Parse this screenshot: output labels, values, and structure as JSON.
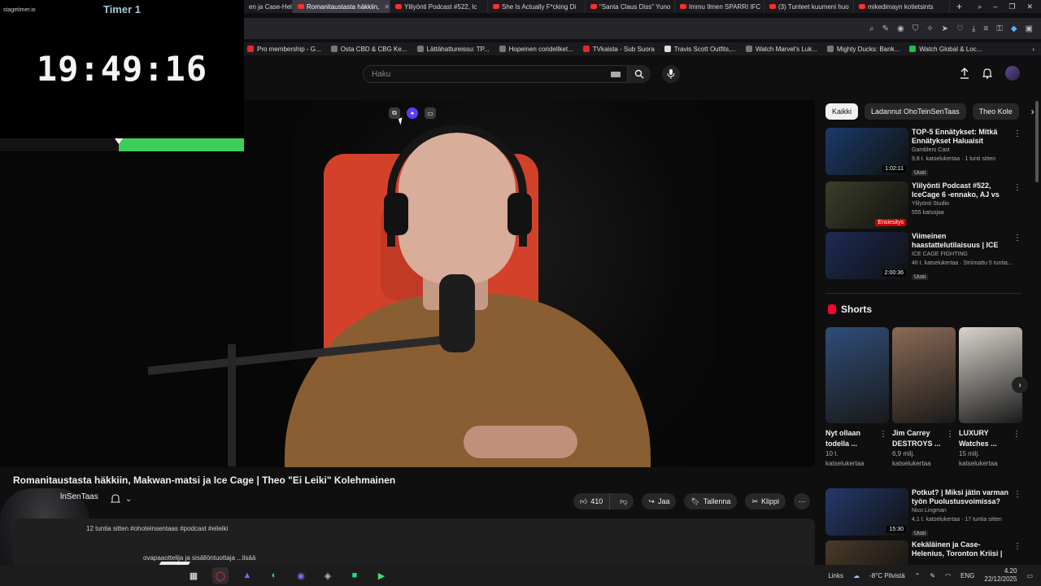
{
  "browser": {
    "tabs": [
      {
        "label": "en ja Case-Heler",
        "active": false
      },
      {
        "label": "Romanitaustasta häkkiin,",
        "active": true
      },
      {
        "label": "Ylilyönti Podcast #522, Ic",
        "active": false
      },
      {
        "label": "She Is Actually F*cking Di",
        "active": false
      },
      {
        "label": "\"Santa Claus Diss\" Yuno",
        "active": false
      },
      {
        "label": "Immu Ilmen SPARRI IFC",
        "active": false
      },
      {
        "label": "(3) Tunteet kuumeni huo",
        "active": false
      },
      {
        "label": "mikedimayn kotietsints",
        "active": false
      }
    ],
    "new_tab": "+",
    "bookmarks": [
      {
        "label": "Pro membership - G...",
        "icon": "red"
      },
      {
        "label": "Osta CBD & CBG Ke...",
        "icon": "gray"
      },
      {
        "label": "Lättähattureissu: TP...",
        "icon": "gray"
      },
      {
        "label": "Hopeinen coridellket...",
        "icon": "gray"
      },
      {
        "label": "TVkaista - Sub Suora",
        "icon": "red"
      },
      {
        "label": "Travis Scott Outfits,...",
        "icon": "wht"
      },
      {
        "label": "Watch Marvel's Luk...",
        "icon": "gray"
      },
      {
        "label": "Mighty Ducks: Bank...",
        "icon": "gray"
      },
      {
        "label": "Watch Global & Loc...",
        "icon": "grn"
      }
    ]
  },
  "timer": {
    "brand": "stagetimer.io",
    "title": "Timer 1",
    "time": "19:49:16",
    "progress": 0.485,
    "fill_color": "#3ecf5a"
  },
  "header": {
    "search_placeholder": "Haku"
  },
  "video": {
    "title": "Romanitaustasta häkkiin, Makwan-matsi ja Ice Cage | Theo \"Ei Leiki\" Kolehmainen",
    "channel": "lnSenTaas",
    "likes": "410",
    "share": "Jaa",
    "save": "Tallenna",
    "clip": "Klippi",
    "desc_line1": "12 tuntia sitten  #ohoteinsentaas #podcast #eileiki",
    "desc_line2": "ovapaaottelija ja sisällöntuottaja  ...lisää"
  },
  "chips": [
    "Kaikki",
    "Ladannut OhoTeinSenTaas",
    "Theo Kole"
  ],
  "recommendations": [
    {
      "title": "TOP-5 Ennätykset: Mitkä Ennätykset Haluaisit Itsellesi?",
      "channel": "Gamblers Cast",
      "stats": "9,8 t. katselukertaa · 1 tunti sitten",
      "badge": "Uusi",
      "duration": "1:02:11",
      "thumb": "#1a3a6a"
    },
    {
      "title": "Ylilyönti Podcast #522, IceCage 6 -ennako, AJ vs Paul, 1vs1 ...",
      "channel": "Ylilyönti Studio",
      "stats": "555 katsojaa",
      "badge": "",
      "duration": "Ensiesitys",
      "thumb": "#3a3f2a"
    },
    {
      "title": "Viimeinen haastattelutilaisuus | ICE CAGE 6",
      "channel": "ICE CAGE FIGHTING",
      "stats": "46 t. katselukertaa · Striimattu 5 tuntia...",
      "badge": "Uusi",
      "duration": "2:00:36",
      "thumb": "#1d2b55"
    }
  ],
  "shorts": {
    "heading": "Shorts",
    "items": [
      {
        "title": "Nyt ollaan todella ...",
        "views": "10 t. katselukertaa",
        "thumb": "#2e4d78"
      },
      {
        "title": "Jim Carrey DESTROYS ...",
        "views": "6,9 milj. katselukertaa",
        "thumb": "#8a6a55"
      },
      {
        "title": "LUXURY Watches ...",
        "views": "15 milj. katselukertaa",
        "thumb": "#d9d4cc"
      }
    ]
  },
  "more_recs": [
    {
      "title": "Potkut? | Miksi jätin varman työn Puolustusvoimissa?",
      "channel": "Nico Lingman",
      "stats": "4,1 t. katselukertaa · 17 tuntia sitten",
      "badge": "Uusi",
      "duration": "15:30",
      "thumb": "#233a6e"
    },
    {
      "title": "Kekäläinen ja Case-Helenius, Toronton Kriisi | Jouni ...",
      "channel": "",
      "stats": "",
      "badge": "",
      "duration": "",
      "thumb": "#4a3a2a"
    }
  ],
  "taskbar": {
    "links": "Links",
    "weather": "-8°C  Pilvistä",
    "lang": "ENG",
    "time": "4.20",
    "date": "22/12/2025"
  }
}
